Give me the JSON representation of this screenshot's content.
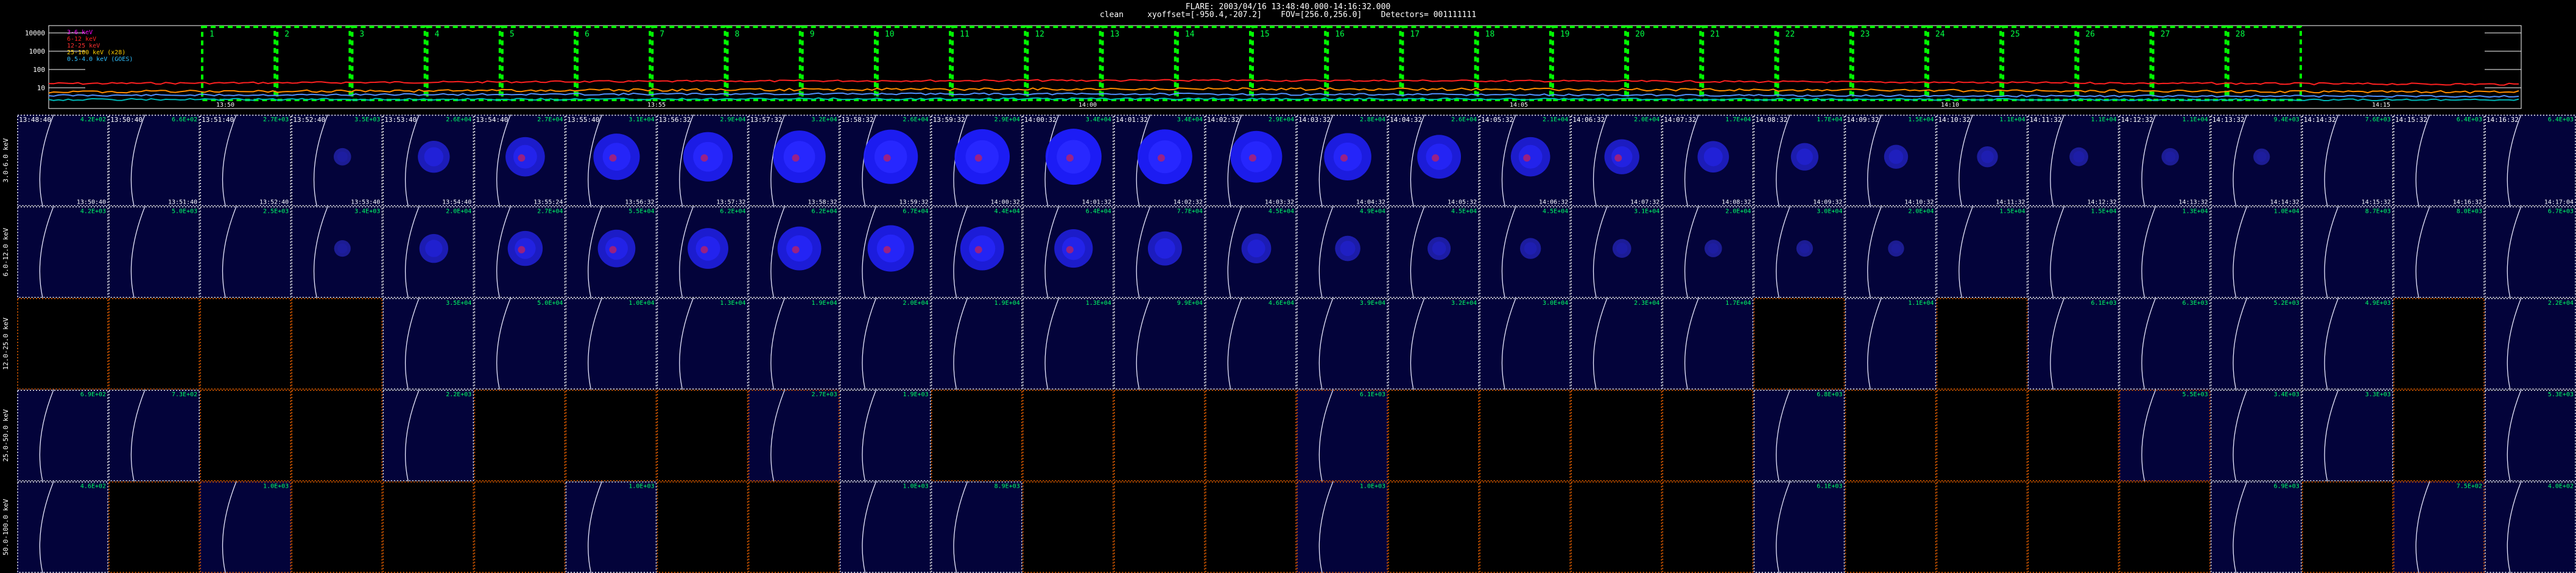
{
  "header": {
    "line1": "FLARE: 2003/04/16 13:48:40.000-14:16:32.000",
    "line2": "clean     xyoffset=[-950.4,-207.2]    FOV=[256.0,256.0]    Detectors= 001111111"
  },
  "lightcurve": {
    "y_ticks": [
      "10000",
      "1000",
      "100",
      "10"
    ],
    "legend": [
      {
        "text": "3-6 keV",
        "color": "#ff00ff"
      },
      {
        "text": "6-12 keV",
        "color": "#ff2020"
      },
      {
        "text": "12-25 keV",
        "color": "#ff3030"
      },
      {
        "text": "25-100 keV (x28)",
        "color": "#ffd000"
      },
      {
        "text": "0.5-4.0 keV (GOES)",
        "color": "#30c0ff"
      }
    ],
    "x_ticks": [
      "13:50",
      "13:55",
      "14:00",
      "14:05",
      "14:10",
      "14:15"
    ],
    "interval_numbers": [
      "1",
      "2",
      "3",
      "4",
      "5",
      "6",
      "7",
      "8",
      "9",
      "10",
      "11",
      "12",
      "13",
      "14",
      "15",
      "16",
      "17",
      "18",
      "19",
      "20",
      "21",
      "22",
      "23",
      "24",
      "25",
      "26",
      "27",
      "28"
    ],
    "colors": {
      "box": "#00ff00",
      "red": "#ff2020",
      "orange": "#ff8c00",
      "blue": "#5090ff",
      "cyan": "#00b8b8",
      "grey": "#bbbbbb"
    }
  },
  "images": {
    "row_labels": [
      "3.0-6.0 keV",
      "6.0-12.0 keV",
      "12.0-25.0 keV",
      "25.0-50.0 keV",
      "50.0-100.0 keV"
    ],
    "start_times": [
      "13:48:40",
      "13:50:40",
      "13:51:40",
      "13:52:40",
      "13:53:40",
      "13:54:40",
      "13:55:40",
      "13:56:32",
      "13:57:32",
      "13:58:32",
      "13:59:32",
      "14:00:32",
      "14:01:32",
      "14:02:32",
      "14:03:32",
      "14:04:32",
      "14:05:32",
      "14:06:32",
      "14:07:32",
      "14:08:32",
      "14:09:32",
      "14:10:32",
      "14:11:32",
      "14:12:32",
      "14:13:32",
      "14:14:32",
      "14:15:32",
      "14:16:32"
    ],
    "end_times": [
      "13:50:40",
      "13:51:40",
      "13:52:40",
      "13:53:40",
      "13:54:40",
      "13:55:24",
      "13:56:32",
      "13:57:32",
      "13:58:32",
      "13:59:32",
      "14:00:32",
      "14:01:32",
      "14:02:32",
      "14:03:32",
      "14:04:32",
      "14:05:32",
      "14:06:32",
      "14:07:32",
      "14:08:32",
      "14:09:32",
      "14:10:32",
      "14:11:32",
      "14:12:32",
      "14:13:32",
      "14:14:32",
      "14:15:32",
      "14:16:32",
      "14:17:04"
    ],
    "max_values": [
      [
        "4.2E+02",
        "6.6E+02",
        "2.7E+03",
        "3.5E+03",
        "2.6E+04",
        "2.7E+04",
        "3.1E+04",
        "2.9E+04",
        "3.2E+04",
        "2.6E+04",
        "2.9E+04",
        "3.4E+04",
        "3.4E+04",
        "2.9E+04",
        "2.8E+04",
        "2.6E+04",
        "2.1E+04",
        "2.0E+04",
        "1.7E+04",
        "1.7E+04",
        "1.5E+04",
        "1.1E+04",
        "1.1E+04",
        "1.1E+04",
        "9.4E+03",
        "7.6E+03",
        "6.4E+03",
        "6.4E+03"
      ],
      [
        "4.2E+03",
        "5.0E+03",
        "2.5E+03",
        "3.4E+03",
        "2.0E+04",
        "2.7E+04",
        "5.5E+04",
        "6.2E+04",
        "6.2E+04",
        "6.7E+04",
        "4.4E+04",
        "6.4E+04",
        "7.7E+04",
        "4.5E+04",
        "4.9E+04",
        "4.5E+04",
        "4.5E+04",
        "3.1E+04",
        "2.0E+04",
        "3.0E+04",
        "2.0E+04",
        "1.5E+04",
        "1.5E+04",
        "1.3E+04",
        "1.0E+04",
        "8.7E+03",
        "8.0E+03",
        "6.7E+03"
      ],
      [
        "",
        "",
        "",
        "",
        "3.5E+04",
        "5.0E+04",
        "1.0E+04",
        "1.3E+04",
        "1.9E+04",
        "2.0E+04",
        "1.9E+04",
        "1.3E+04",
        "9.9E+04",
        "4.6E+04",
        "3.9E+04",
        "3.2E+04",
        "3.0E+04",
        "2.3E+04",
        "1.7E+04",
        "",
        "1.1E+04",
        "",
        "6.1E+03",
        "6.3E+03",
        "5.2E+03",
        "4.9E+03",
        "",
        "2.2E+04"
      ],
      [
        "6.9E+02",
        "7.3E+02",
        "",
        "",
        "2.2E+03",
        "",
        "",
        "",
        "2.7E+03",
        "1.9E+03",
        "",
        "",
        "",
        "",
        "6.1E+03",
        "",
        "",
        "",
        "",
        "6.8E+03",
        "",
        "",
        "",
        "5.5E+03",
        "3.4E+03",
        "3.3E+03",
        "",
        "5.3E+03"
      ],
      [
        "4.6E+02",
        "",
        "1.0E+03",
        "",
        "",
        "",
        "1.0E+03",
        "",
        "",
        "1.0E+03",
        "8.9E+03",
        "",
        "",
        "",
        "1.0E+03",
        "",
        "",
        "",
        "",
        "6.1E+03",
        "",
        "",
        "",
        "",
        "6.9E+03",
        "",
        "7.5E+02",
        "4.0E+02"
      ]
    ]
  },
  "colors": {
    "tile_bg": "#03033a",
    "missing_bg": "#000000",
    "dotted_white": "#ffffff",
    "dotted_orange": "#ff6a00",
    "value_green": "#00ff66",
    "time_text": "#ffffff"
  },
  "intensity": [
    [
      0.03,
      0.04,
      0.06,
      0.12,
      0.45,
      0.62,
      0.78,
      0.85,
      0.92,
      0.96,
      0.98,
      1.0,
      0.97,
      0.9,
      0.8,
      0.72,
      0.62,
      0.52,
      0.44,
      0.35,
      0.27,
      0.2,
      0.15,
      0.12,
      0.1,
      0.08,
      0.06,
      0.05
    ],
    [
      0.02,
      0.04,
      0.05,
      0.1,
      0.38,
      0.52,
      0.58,
      0.65,
      0.72,
      0.78,
      0.72,
      0.6,
      0.5,
      0.4,
      0.3,
      0.25,
      0.2,
      0.15,
      0.12,
      0.1,
      0.09,
      0.08,
      0.07,
      0.06,
      0.05,
      0.05,
      0.04,
      0.04
    ]
  ]
}
